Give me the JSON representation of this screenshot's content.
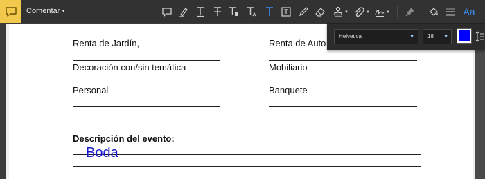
{
  "toolbar": {
    "comment_menu_label": "Comentar",
    "tools": [
      {
        "name": "sticky-note-icon"
      },
      {
        "name": "highlight-icon"
      },
      {
        "name": "underline-text-icon"
      },
      {
        "name": "strikethrough-text-icon"
      },
      {
        "name": "replace-text-icon"
      },
      {
        "name": "insert-text-icon"
      },
      {
        "name": "add-text-comment-icon"
      },
      {
        "name": "text-box-icon"
      },
      {
        "name": "pencil-icon"
      },
      {
        "name": "eraser-icon"
      },
      {
        "name": "stamp-icon"
      },
      {
        "name": "attach-file-icon"
      },
      {
        "name": "signature-icon"
      },
      {
        "name": "pin-icon"
      },
      {
        "name": "fill-color-icon"
      },
      {
        "name": "line-weight-icon"
      },
      {
        "name": "text-properties-icon",
        "label": "Aa"
      }
    ]
  },
  "properties": {
    "font": "Helvetica",
    "size": "18",
    "color": "#0000ff"
  },
  "document": {
    "fields_left": [
      "Renta de Jardín,",
      "Decoración con/sin temática",
      "Personal"
    ],
    "fields_right": [
      "Renta de Auto",
      "Mobiliario",
      "Banquete"
    ],
    "description_title": "Descripción del evento:",
    "typed_text": "Boda"
  },
  "colors": {
    "toolbar_bg": "#323232",
    "comment_badge": "#f2c94c",
    "accent_blue": "#3b8ff0",
    "typed_text": "#1a1acd"
  }
}
